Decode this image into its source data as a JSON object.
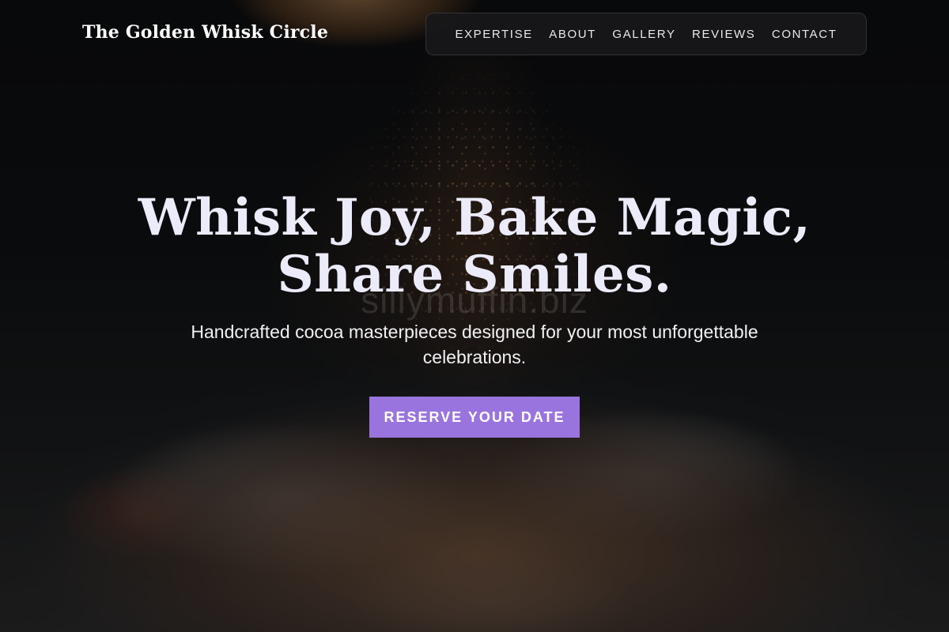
{
  "site": {
    "brand": "The Golden Whisk Circle"
  },
  "nav": {
    "items": [
      "EXPERTISE",
      "ABOUT",
      "GALLERY",
      "REVIEWS",
      "CONTACT"
    ]
  },
  "hero": {
    "title_line1": "Whisk Joy, Bake Magic,",
    "title_line2": "Share Smiles.",
    "subtitle": "Handcrafted cocoa masterpieces designed for your most unforgettable celebrations.",
    "watermark": "sillymuffin.biz",
    "cta_label": "RESERVE YOUR DATE"
  },
  "colors": {
    "accent": "#9a74de",
    "title": "#ecebfa",
    "nav_bg": "#18181a"
  }
}
